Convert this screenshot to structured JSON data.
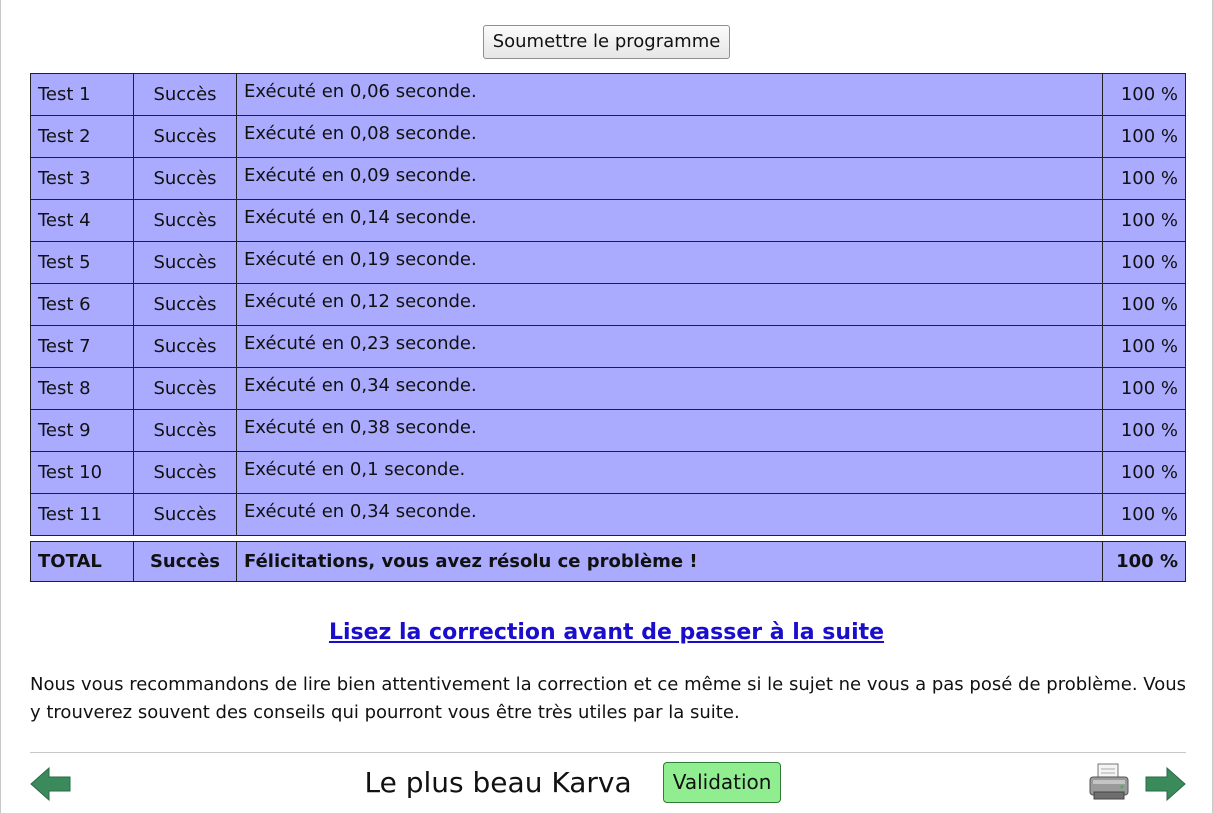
{
  "submit": {
    "label": "Soumettre le programme"
  },
  "results": {
    "rows": [
      {
        "name": "Test 1",
        "status": "Succès",
        "message": "Exécuté en 0,06 seconde.",
        "score": "100 %"
      },
      {
        "name": "Test 2",
        "status": "Succès",
        "message": "Exécuté en 0,08 seconde.",
        "score": "100 %"
      },
      {
        "name": "Test 3",
        "status": "Succès",
        "message": "Exécuté en 0,09 seconde.",
        "score": "100 %"
      },
      {
        "name": "Test 4",
        "status": "Succès",
        "message": "Exécuté en 0,14 seconde.",
        "score": "100 %"
      },
      {
        "name": "Test 5",
        "status": "Succès",
        "message": "Exécuté en 0,19 seconde.",
        "score": "100 %"
      },
      {
        "name": "Test 6",
        "status": "Succès",
        "message": "Exécuté en 0,12 seconde.",
        "score": "100 %"
      },
      {
        "name": "Test 7",
        "status": "Succès",
        "message": "Exécuté en 0,23 seconde.",
        "score": "100 %"
      },
      {
        "name": "Test 8",
        "status": "Succès",
        "message": "Exécuté en 0,34 seconde.",
        "score": "100 %"
      },
      {
        "name": "Test 9",
        "status": "Succès",
        "message": "Exécuté en 0,38 seconde.",
        "score": "100 %"
      },
      {
        "name": "Test 10",
        "status": "Succès",
        "message": "Exécuté en 0,1 seconde.",
        "score": "100 %"
      },
      {
        "name": "Test 11",
        "status": "Succès",
        "message": "Exécuté en 0,34 seconde.",
        "score": "100 %"
      }
    ],
    "total": {
      "name": "TOTAL",
      "status": "Succès",
      "message": "Félicitations, vous avez résolu ce problème !",
      "score": "100 %"
    },
    "row_color": "#aaaaff"
  },
  "correction_link": "Lisez la correction avant de passer à la suite",
  "advice": "Nous vous recommandons de lire bien attentivement la correction et ce même si le sujet ne vous a pas posé de problème. Vous y trouverez souvent des conseils qui pourront vous être très utiles par la suite.",
  "footer": {
    "title": "Le plus beau Karva",
    "validation_label": "Validation",
    "validation_color": "#90ee90",
    "prev_icon": "arrow-left-icon",
    "next_icon": "arrow-right-icon",
    "print_icon": "printer-icon",
    "arrow_color": "#3a8a5c"
  }
}
